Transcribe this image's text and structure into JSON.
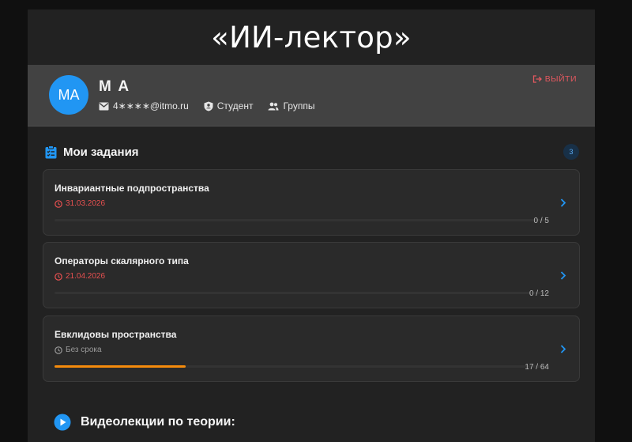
{
  "app": {
    "title": "«ИИ-лектор»"
  },
  "profile": {
    "avatar_initials": "MA",
    "name": "M A",
    "email": "4∗∗∗∗@itmo.ru",
    "role": "Студент",
    "groups_label": "Группы",
    "logout_label": "ВЫЙТИ"
  },
  "tasks_section": {
    "title": "Мои задания",
    "count": "3",
    "items": [
      {
        "title": "Инвариантные подпространства",
        "deadline": "31.03.2026",
        "deadline_state": "overdue",
        "progress_text": "0 / 5",
        "progress_fraction": 0.0
      },
      {
        "title": "Операторы скалярного типа",
        "deadline": "21.04.2026",
        "deadline_state": "overdue",
        "progress_text": "0 / 12",
        "progress_fraction": 0.0
      },
      {
        "title": "Евклидовы пространства",
        "deadline": "Без срока",
        "deadline_state": "none",
        "progress_text": "17 / 64",
        "progress_fraction": 0.2656
      }
    ]
  },
  "video_section": {
    "title": "Видеолекции по теории:"
  },
  "colors": {
    "accent": "#2196f3",
    "danger": "#e85050",
    "progress": "#f58b0c",
    "logout": "#e2585f"
  }
}
